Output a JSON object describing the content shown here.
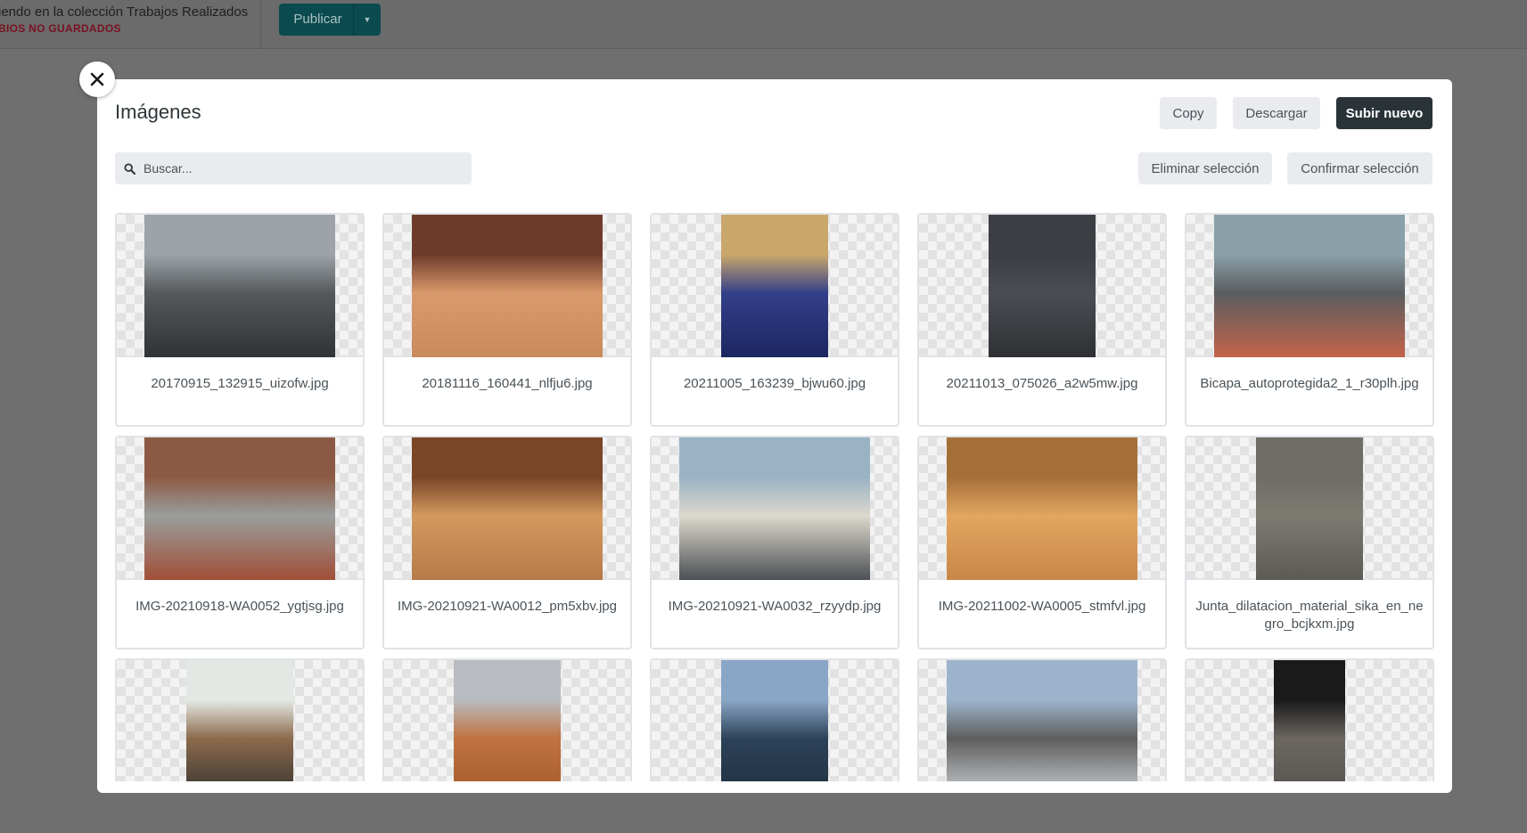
{
  "header": {
    "status_line": "iendo en la colección Trabajos Realizados",
    "unsaved": "BIOS NO GUARDADOS",
    "publish_label": "Publicar"
  },
  "modal": {
    "title": "Imágenes",
    "copy_label": "Copy",
    "download_label": "Descargar",
    "upload_label": "Subir nuevo",
    "delete_selection_label": "Eliminar selección",
    "confirm_selection_label": "Confirmar selección",
    "search_placeholder": "Buscar..."
  },
  "images": [
    {
      "name": "20170915_132915_uizofw.jpg",
      "colors": [
        "#9da3a8",
        "#55595c",
        "#2f3336"
      ]
    },
    {
      "name": "20181116_160441_nlfju6.jpg",
      "colors": [
        "#6e3b2b",
        "#d99a6c",
        "#c98a5c"
      ]
    },
    {
      "name": "20211005_163239_bjwu60.jpg",
      "colors": [
        "#c9a66a",
        "#33408a",
        "#1c2660"
      ]
    },
    {
      "name": "20211013_075026_a2w5mw.jpg",
      "colors": [
        "#3b3e43",
        "#4a4d52",
        "#2e3034"
      ]
    },
    {
      "name": "Bicapa_autoprotegida2_1_r30plh.jpg",
      "colors": [
        "#8aa0a8",
        "#5a5d60",
        "#c4634a"
      ]
    },
    {
      "name": "IMG-20210918-WA0052_ygtjsg.jpg",
      "colors": [
        "#8c5a44",
        "#9a9d9c",
        "#a14e36"
      ]
    },
    {
      "name": "IMG-20210921-WA0012_pm5xbv.jpg",
      "colors": [
        "#7a4628",
        "#d39a5f",
        "#b57a48"
      ]
    },
    {
      "name": "IMG-20210921-WA0032_rzyydp.jpg",
      "colors": [
        "#9ab3c4",
        "#dcd8cc",
        "#4c5054"
      ]
    },
    {
      "name": "IMG-20211002-WA0005_stmfvl.jpg",
      "colors": [
        "#a56f3a",
        "#e2a660",
        "#c88747"
      ]
    },
    {
      "name": "Junta_dilatacion_material_sika_en_negro_bcjkxm.jpg",
      "colors": [
        "#6e6e66",
        "#7c7b72",
        "#5b5a54"
      ]
    },
    {
      "name": "",
      "colors": [
        "#e3e8e4",
        "#8c6a4c",
        "#2e2e2e"
      ]
    },
    {
      "name": "",
      "colors": [
        "#b8bcc0",
        "#c07240",
        "#a45a2c"
      ]
    },
    {
      "name": "",
      "colors": [
        "#8aa6c6",
        "#2c4258",
        "#203040"
      ]
    },
    {
      "name": "",
      "colors": [
        "#9db4cc",
        "#5e5e5e",
        "#d4d8dc"
      ]
    },
    {
      "name": "",
      "colors": [
        "#1a1a1a",
        "#6b6660",
        "#55524d"
      ]
    }
  ]
}
